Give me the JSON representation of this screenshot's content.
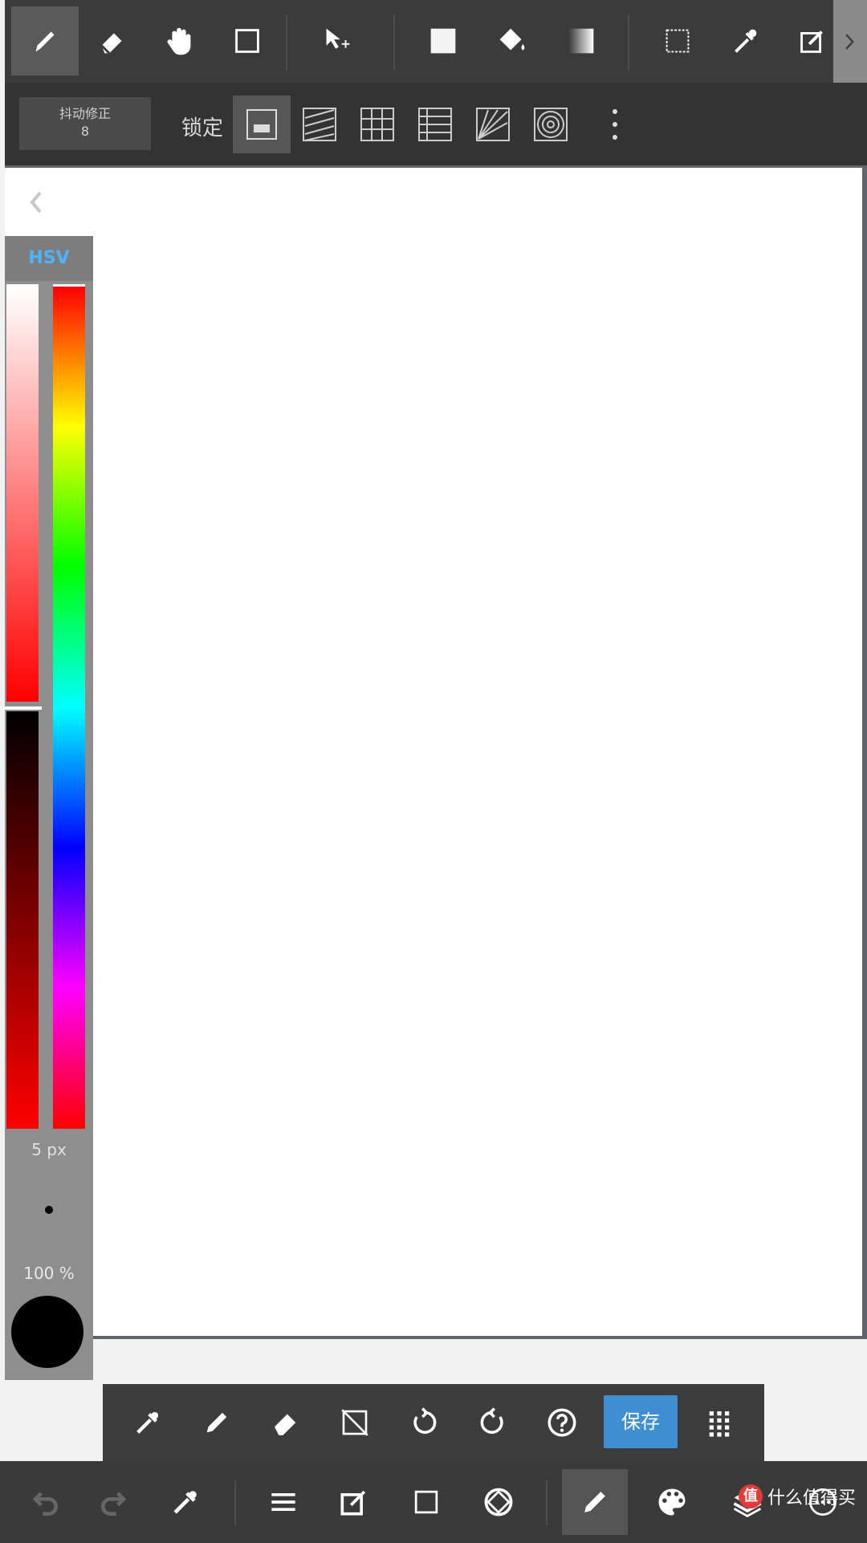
{
  "top_toolbar": {
    "tools": [
      "brush-icon",
      "eraser-icon",
      "hand-icon",
      "rectangle-icon",
      "move-select-icon",
      "fill-square-icon",
      "bucket-icon",
      "gradient-icon",
      "select-rect-icon",
      "eyedropper-icon",
      "edit-icon"
    ]
  },
  "second_toolbar": {
    "stabilizer_label": "抖动修正",
    "stabilizer_value": "8",
    "lock_label": "锁定"
  },
  "color_panel": {
    "tab_label": "HSV",
    "brush_size": "5 px",
    "opacity": "100 %",
    "current_color": "#000000",
    "saturation_fraction": 1.0
  },
  "quickbar": {
    "save_label": "保存"
  },
  "watermark": {
    "logo": "值",
    "text": "什么值得买"
  },
  "colors": {
    "accent": "#3f8fd2",
    "hsv_tab": "#4fb4ff"
  }
}
